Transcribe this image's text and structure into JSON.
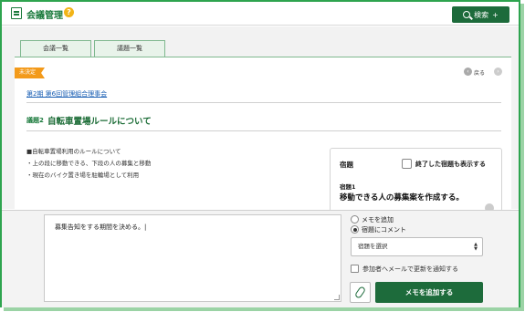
{
  "header": {
    "app_title": "会議管理",
    "help": "?",
    "search_label": "検索",
    "search_plus": "+"
  },
  "tabs": [
    {
      "label": "会議一覧"
    },
    {
      "label": "議題一覧"
    }
  ],
  "status": {
    "label": "未決定"
  },
  "nav": {
    "prev_label": "戻る"
  },
  "meeting": {
    "link": "第2期 第6回管理組合理事会"
  },
  "agenda": {
    "prefix": "議題2",
    "title": "自転車置場ルールについて"
  },
  "body_lines": [
    "■自転車置場利用のルールについて",
    "・上の段に移動できる、下段の人の募集と移動",
    "・現在のバイク置き場を駐輪場として利用"
  ],
  "homework": {
    "heading": "宿題",
    "show_done_label": "終了した宿題も表示する",
    "item_number": "宿題1",
    "item_text": "移動できる人の募集案を作成する。"
  },
  "memo": {
    "text": "募集告知をする期間を決める。|",
    "radio_memo": "メモを追加",
    "radio_comment": "宿題にコメント",
    "select_value": "宿題を選択",
    "notify_label": "参加者へメールで更新を通知する",
    "add_button": "メモを追加する"
  },
  "colors": {
    "brand_green": "#1d6b3b",
    "badge_orange": "#f39a1a",
    "link_blue": "#1a5fb4"
  }
}
